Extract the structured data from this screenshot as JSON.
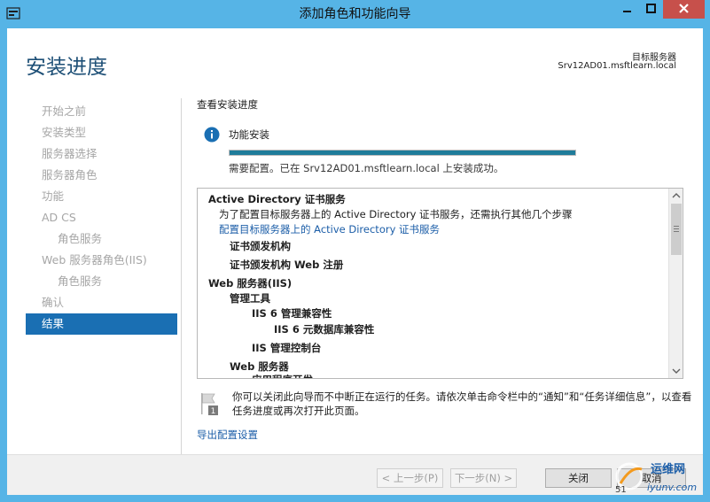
{
  "window": {
    "title": "添加角色和功能向导"
  },
  "header": {
    "title": "安装进度",
    "target_label": "目标服务器",
    "target_value": "Srv12AD01.msftlearn.local"
  },
  "nav": {
    "items": [
      {
        "label": "开始之前",
        "level": 0,
        "active": false
      },
      {
        "label": "安装类型",
        "level": 0,
        "active": false
      },
      {
        "label": "服务器选择",
        "level": 0,
        "active": false
      },
      {
        "label": "服务器角色",
        "level": 0,
        "active": false
      },
      {
        "label": "功能",
        "level": 0,
        "active": false
      },
      {
        "label": "AD CS",
        "level": 0,
        "active": false
      },
      {
        "label": "角色服务",
        "level": 1,
        "active": false
      },
      {
        "label": "Web 服务器角色(IIS)",
        "level": 0,
        "active": false
      },
      {
        "label": "角色服务",
        "level": 1,
        "active": false
      },
      {
        "label": "确认",
        "level": 0,
        "active": false
      },
      {
        "label": "结果",
        "level": 0,
        "active": true
      }
    ]
  },
  "main": {
    "section_title": "查看安装进度",
    "feature_label": "功能安装",
    "progress_fraction": 1.0,
    "status_line": "需要配置。已在 Srv12AD01.msftlearn.local 上安装成功。",
    "results": [
      {
        "text": "Active Directory 证书服务",
        "style": "bold",
        "indent": 0
      },
      {
        "text": "为了配置目标服务器上的 Active Directory 证书服务，还需执行其他几个步骤",
        "style": "normal",
        "indent": 1
      },
      {
        "text": "配置目标服务器上的 Active Directory 证书服务",
        "style": "link",
        "indent": 1
      },
      {
        "text": "证书颁发机构",
        "style": "bold",
        "indent": 2
      },
      {
        "text": "证书颁发机构 Web 注册",
        "style": "bold",
        "indent": 2
      },
      {
        "text": "Web 服务器(IIS)",
        "style": "bold",
        "indent": 0
      },
      {
        "text": "管理工具",
        "style": "bold",
        "indent": 2
      },
      {
        "text": "IIS 6 管理兼容性",
        "style": "bold",
        "indent": 3
      },
      {
        "text": "IIS 6 元数据库兼容性",
        "style": "bold",
        "indent": 4
      },
      {
        "text": "IIS 管理控制台",
        "style": "bold",
        "indent": 3
      },
      {
        "text": "Web 服务器",
        "style": "bold",
        "indent": 2
      },
      {
        "text": "应用程序开发",
        "style": "bold",
        "indent": 3
      }
    ],
    "note": "你可以关闭此向导而不中断正在运行的任务。请依次单击命令栏中的“通知”和“任务详细信息”，以查看任务进度或再次打开此页面。",
    "export_link": "导出配置设置"
  },
  "footer": {
    "prev_label": "< 上一步(P)",
    "next_label": "下一步(N) >",
    "close_label": "关闭",
    "cancel_label": "取消"
  },
  "watermark": {
    "line1": "运维网",
    "line2": "iyunv.com",
    "prefix": "51"
  },
  "colors": {
    "accent": "#1a6fb3",
    "title_bar": "#56b4e6",
    "close_button": "#c7504b",
    "progress": "#1f7c9a",
    "link": "#1c5ea8"
  }
}
